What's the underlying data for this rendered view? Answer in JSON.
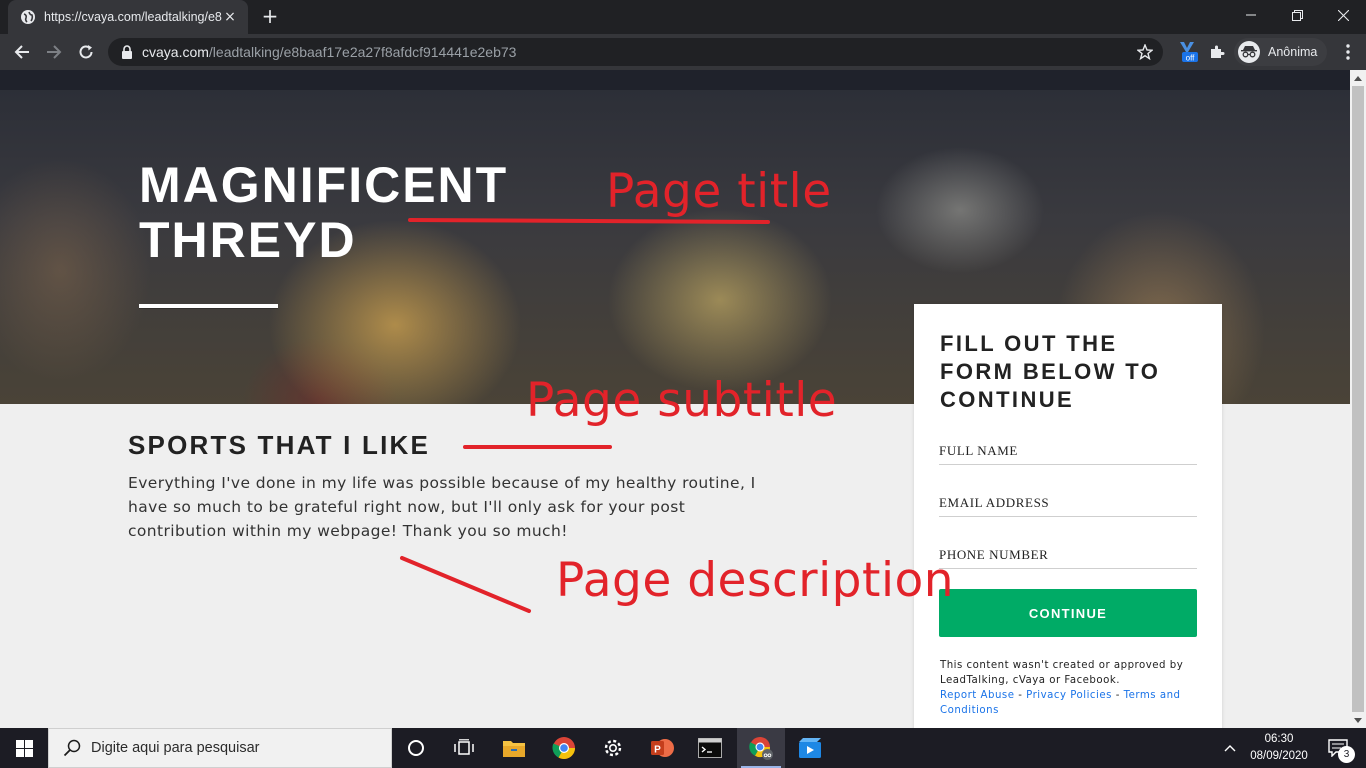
{
  "browser": {
    "tab_title": "https://cvaya.com/leadtalking/e8",
    "tab_close": "×",
    "new_tab": "+",
    "url_host": "cvaya.com",
    "url_path": "/leadtalking/e8baaf17e2a27f8afdcf914441e2eb73",
    "extension_badge": "off",
    "profile_name": "Anônima"
  },
  "hero": {
    "title_line1": "MAGNIFICENT",
    "title_line2": "THREYD"
  },
  "content": {
    "heading": "SPORTS THAT I LIKE",
    "description": "Everything I've done in my life was possible because of my healthy routine, I have so much to be grateful right now, but I'll only ask for your post contribution within my webpage! Thank you so much!"
  },
  "annotations": {
    "title": "Page title",
    "subtitle": "Page subtitle",
    "description": "Page description",
    "color": "#e2232a"
  },
  "form": {
    "title": "FILL OUT THE FORM BELOW TO CONTINUE",
    "full_name_placeholder": "FULL NAME",
    "email_placeholder": "EMAIL ADDRESS",
    "phone_placeholder": "PHONE NUMBER",
    "continue_label": "CONTINUE",
    "button_color": "#00ab66",
    "disclaimer": "This content wasn't created or approved by LeadTalking, cVaya or Facebook.",
    "link_report": "Report Abuse",
    "link_privacy": "Privacy Policies",
    "link_terms": "Terms and Conditions",
    "separator": " - "
  },
  "taskbar": {
    "search_placeholder": "Digite aqui para pesquisar",
    "time": "06:30",
    "date": "08/09/2020",
    "notification_count": "3",
    "icons": [
      "cortana-icon",
      "task-view-icon",
      "file-explorer-icon",
      "chrome-icon",
      "settings-icon",
      "powerpoint-icon",
      "terminal-icon",
      "chrome-incognito-icon",
      "media-app-icon"
    ]
  }
}
